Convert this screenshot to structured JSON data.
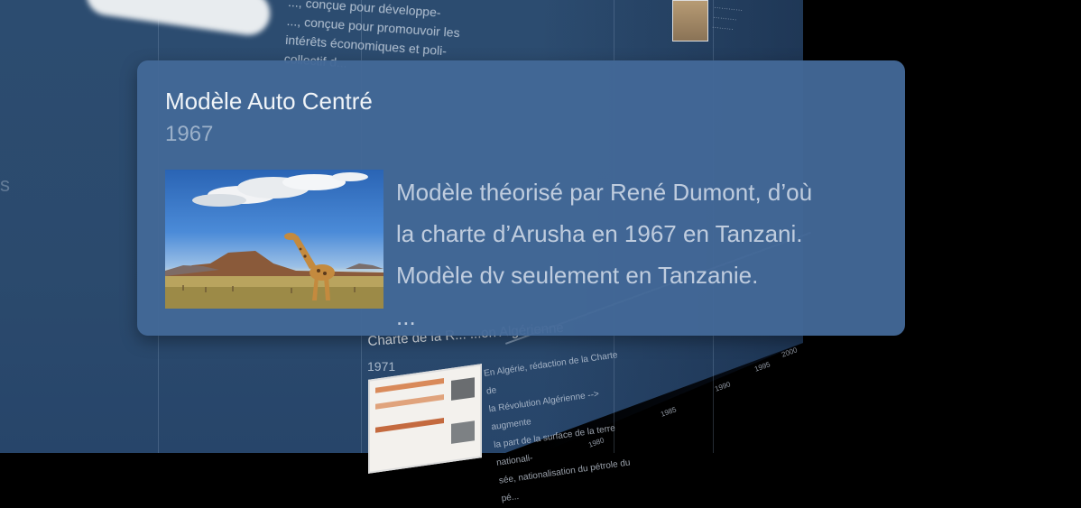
{
  "popup": {
    "title": "Modèle Auto Centré",
    "year": "1967",
    "description_lines": [
      "Modèle théorisé par René Dumont, d’où",
      "la charte d’Arusha en 1967 en Tanzani.",
      "Modèle dv seulement en Tanzanie.",
      "..."
    ]
  },
  "background_event_top": {
    "text_lines": [
      "..., conçue pour développe-",
      "..., conçue pour promouvoir les",
      "intérêts économiques et poli-",
      "collectif d..."
    ]
  },
  "background_event_bottom": {
    "title": "Charte de la R... ...on Algérienne",
    "year": "1971",
    "text_lines": [
      "En Algérie, rédaction de la Charte de",
      "la Révolution Algérienne --> augmente",
      "la part de la surface de la terre nationali-",
      "sée, nationalisation du pétrole du pé..."
    ]
  },
  "timeline_axis_labels": [
    "1980",
    "1985",
    "1990",
    "1995",
    "2000"
  ],
  "colors": {
    "wall": "#2c4c70",
    "popup": "#436897",
    "outside": "#000000"
  }
}
